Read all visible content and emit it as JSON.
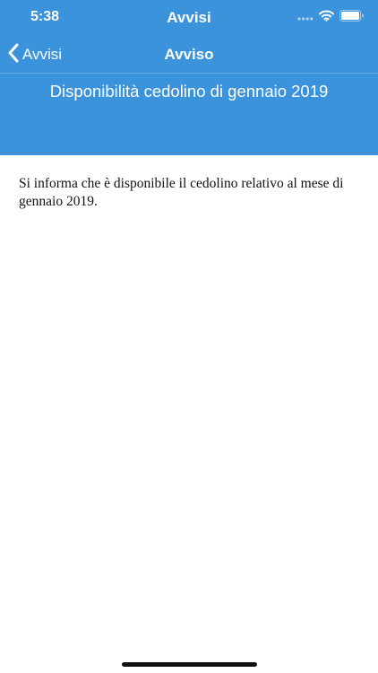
{
  "status_bar": {
    "time": "5:38",
    "app_title": "Avvisi",
    "icons": [
      "signal-dots-icon",
      "wifi-icon",
      "battery-icon"
    ]
  },
  "nav": {
    "back_label": "Avvisi",
    "title": "Avviso"
  },
  "notice": {
    "title": "Disponibilità cedolino di gennaio 2019",
    "body": "Si informa che è disponibile il cedolino relativo al mese di gennaio 2019."
  },
  "colors": {
    "header_blue": "#3b93dc",
    "text_white": "#ffffff",
    "body_text": "#111111"
  }
}
